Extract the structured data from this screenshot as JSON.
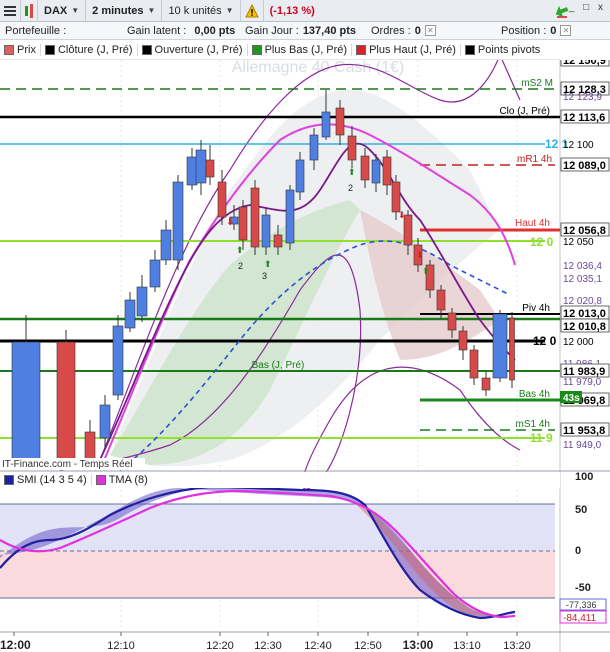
{
  "toolbar": {
    "symbol": "DAX",
    "timeframe": "2 minutes",
    "quantity": "10 k unités",
    "change": "(-1,13 %)",
    "window_controls": "_ □ x"
  },
  "account": {
    "portfolio_label": "Portefeuille :",
    "latent_label": "Gain latent :",
    "latent_value": "0,00 pts",
    "day_label": "Gain Jour :",
    "day_value": "137,40 pts",
    "orders_label": "Ordres :",
    "orders_value": "0",
    "position_label": "Position :",
    "position_value": "0"
  },
  "legend": {
    "items": [
      {
        "label": "Prix",
        "color": "#e06060"
      },
      {
        "label": "Clôture (J, Pré)",
        "color": "#000000"
      },
      {
        "label": "Ouverture (J, Pré)",
        "color": "#000000"
      },
      {
        "label": "Plus Bas (J, Pré)",
        "color": "#1a9a1a"
      },
      {
        "label": "Plus Haut (J, Pré)",
        "color": "#e02020"
      },
      {
        "label": "Points pivots",
        "color": "#000000"
      }
    ]
  },
  "chart": {
    "watermark": "Allemagne 40 Cash (1€)",
    "source": "IT-Finance.com - Temps Réel",
    "line_labels": {
      "ms2": "mS2 M",
      "clo": "Clo (J, Pré)",
      "mr1": "mR1 4h",
      "haut4h": "Haut 4h",
      "piv4h": "Piv 4h",
      "bas_j": "Bas (J, Pré)",
      "bas4h": "Bas 4h",
      "ms1": "mS1 4h",
      "timer": "43s",
      "cyan_cut": "12 1",
      "green_cut": "12 0",
      "black_cut": "12 0",
      "lime_cut": "11 9"
    },
    "price_labels": [
      {
        "text": "12 150,9",
        "color": "#000000"
      },
      {
        "text": "12 128,3",
        "color": "#000000"
      },
      {
        "text": "12 123,9",
        "color": "#6a4a9a"
      },
      {
        "text": "12 113,6",
        "color": "#000000"
      },
      {
        "text": "12 100",
        "color": "#000000"
      },
      {
        "text": "12 089,0",
        "color": "#000000"
      },
      {
        "text": "12 056,8",
        "color": "#000000"
      },
      {
        "text": "12 050",
        "color": "#000000"
      },
      {
        "text": "12 036,4",
        "color": "#6a4a9a"
      },
      {
        "text": "12 035,1",
        "color": "#6a4a9a"
      },
      {
        "text": "12 020,8",
        "color": "#6a4a9a"
      },
      {
        "text": "12 013,0",
        "color": "#000000"
      },
      {
        "text": "12 010,8",
        "color": "#000000"
      },
      {
        "text": "12 000",
        "color": "#000000"
      },
      {
        "text": "11 986,1",
        "color": "#6a4a9a"
      },
      {
        "text": "11 983,9",
        "color": "#000000"
      },
      {
        "text": "11 979,0",
        "color": "#6a4a9a"
      },
      {
        "text": "11 969,8",
        "color": "#000000"
      },
      {
        "text": "11 953,8",
        "color": "#000000"
      },
      {
        "text": "11 949,0",
        "color": "#6a4a9a"
      }
    ]
  },
  "smi": {
    "label": "SMI (14 3 5 4)",
    "tma_label": "TMA (8)",
    "scale": [
      "100",
      "50",
      "0",
      "-50",
      "-100"
    ],
    "values": [
      "-77,336",
      "-84,411"
    ]
  },
  "time_axis": [
    "12:00",
    "12:10",
    "12:20",
    "12:30",
    "12:40",
    "12:50",
    "13:00",
    "13:10",
    "13:20"
  ],
  "colors": {
    "up_candle": "#4f7fe0",
    "down_candle": "#d84a4a",
    "smi_line": "#3030b0",
    "tma_line": "#e040e0",
    "pivot_green": "#1a7a1a",
    "lime": "#90e030",
    "cyan": "#30b0e0",
    "red_level": "#e03030"
  }
}
